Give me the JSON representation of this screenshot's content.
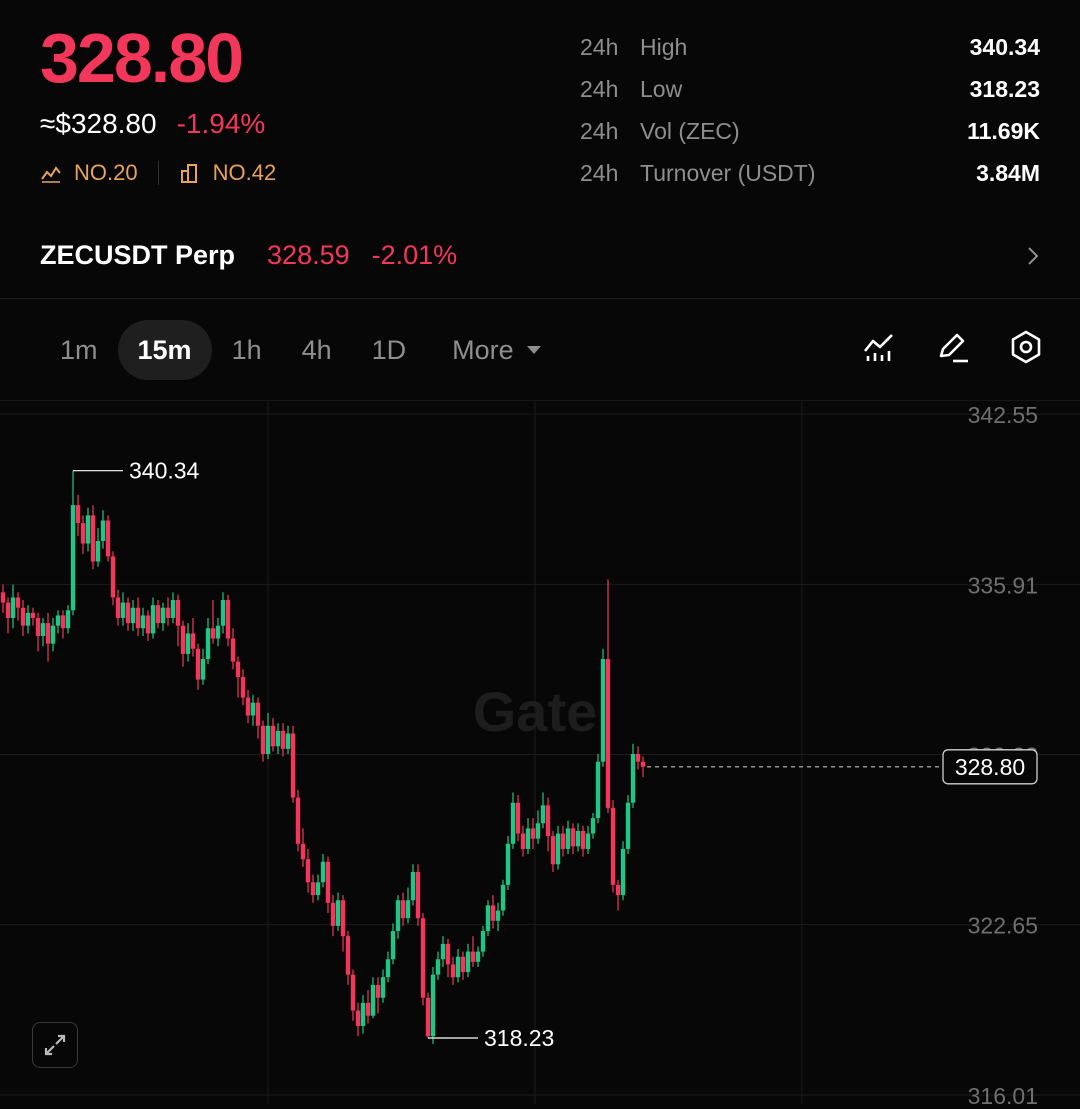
{
  "ticker": {
    "last_price": "328.80",
    "usd_price": "≈$328.80",
    "change_pct": "-1.94%",
    "rank_1": "NO.20",
    "rank_2": "NO.42"
  },
  "stats": [
    {
      "period": "24h",
      "name": "High",
      "value": "340.34"
    },
    {
      "period": "24h",
      "name": "Low",
      "value": "318.23"
    },
    {
      "period": "24h",
      "name": "Vol (ZEC)",
      "value": "11.69K"
    },
    {
      "period": "24h",
      "name": "Turnover (USDT)",
      "value": "3.84M"
    }
  ],
  "perp": {
    "symbol": "ZECUSDT Perp",
    "price": "328.59",
    "change": "-2.01%"
  },
  "timeframes": {
    "items": [
      "1m",
      "15m",
      "1h",
      "4h",
      "1D"
    ],
    "active": "15m",
    "more_label": "More"
  },
  "icons": {
    "indicator": "indicator-icon",
    "draw": "pencil-icon",
    "settings": "settings-hexagon-icon",
    "expand": "expand-icon"
  },
  "colors": {
    "up": "#1fc685",
    "down": "#f2375b",
    "rank": "#e8a25a",
    "background": "#070707"
  },
  "chart_data": {
    "type": "candlestick",
    "watermark": "Gate",
    "y_ticks": [
      "342.55",
      "335.91",
      "329.28",
      "322.65",
      "316.01"
    ],
    "ylim": [
      316.01,
      342.55
    ],
    "last_price_label": "328.80",
    "last_price": 328.8,
    "high_label": "340.34",
    "high": 340.34,
    "low_label": "318.23",
    "low": 318.23,
    "candles": [
      [
        335.6,
        335.2,
        335.9,
        334.8
      ],
      [
        335.2,
        334.6,
        335.4,
        334.0
      ],
      [
        334.6,
        335.4,
        335.9,
        334.2
      ],
      [
        335.4,
        335.0,
        335.6,
        334.5
      ],
      [
        335.0,
        334.3,
        335.3,
        333.9
      ],
      [
        334.3,
        334.8,
        335.1,
        334.0
      ],
      [
        334.8,
        334.6,
        335.0,
        334.3
      ],
      [
        334.6,
        333.9,
        334.8,
        333.3
      ],
      [
        333.9,
        334.4,
        334.6,
        333.5
      ],
      [
        334.4,
        333.6,
        334.8,
        332.9
      ],
      [
        333.6,
        334.3,
        334.6,
        333.3
      ],
      [
        334.3,
        334.7,
        334.9,
        334.0
      ],
      [
        334.7,
        334.2,
        334.9,
        333.8
      ],
      [
        334.2,
        334.9,
        335.1,
        334.0
      ],
      [
        334.9,
        339.0,
        340.34,
        334.7
      ],
      [
        339.0,
        338.3,
        339.4,
        337.8
      ],
      [
        338.3,
        337.5,
        338.6,
        337.1
      ],
      [
        337.5,
        338.6,
        338.9,
        337.2
      ],
      [
        338.6,
        336.8,
        339.0,
        336.5
      ],
      [
        336.8,
        337.6,
        338.1,
        336.6
      ],
      [
        337.6,
        338.4,
        338.8,
        337.3
      ],
      [
        338.4,
        337.0,
        338.6,
        336.8
      ],
      [
        337.0,
        335.4,
        337.2,
        335.1
      ],
      [
        335.4,
        334.6,
        335.7,
        334.3
      ],
      [
        334.6,
        335.2,
        335.6,
        334.3
      ],
      [
        335.2,
        334.4,
        335.4,
        334.1
      ],
      [
        334.4,
        335.0,
        335.3,
        334.1
      ],
      [
        335.0,
        334.2,
        335.4,
        333.9
      ],
      [
        334.2,
        334.7,
        335.0,
        333.9
      ],
      [
        334.7,
        334.0,
        334.9,
        333.7
      ],
      [
        334.0,
        335.1,
        335.4,
        333.8
      ],
      [
        335.1,
        334.4,
        335.3,
        334.2
      ],
      [
        334.4,
        335.0,
        335.2,
        334.1
      ],
      [
        335.0,
        334.6,
        335.4,
        334.3
      ],
      [
        334.6,
        335.3,
        335.6,
        334.4
      ],
      [
        335.3,
        334.3,
        335.5,
        333.5
      ],
      [
        334.3,
        333.2,
        334.5,
        332.7
      ],
      [
        333.2,
        334.0,
        334.4,
        332.9
      ],
      [
        334.0,
        333.4,
        334.6,
        333.1
      ],
      [
        333.4,
        332.2,
        333.6,
        331.8
      ],
      [
        332.2,
        333.0,
        333.4,
        332.0
      ],
      [
        333.0,
        334.2,
        334.6,
        332.8
      ],
      [
        334.2,
        333.8,
        335.3,
        333.6
      ],
      [
        333.8,
        334.3,
        334.6,
        333.5
      ],
      [
        334.3,
        335.3,
        335.6,
        334.0
      ],
      [
        335.3,
        333.8,
        335.5,
        333.5
      ],
      [
        333.8,
        332.9,
        334.2,
        332.6
      ],
      [
        332.9,
        332.3,
        333.1,
        331.5
      ],
      [
        332.3,
        331.5,
        332.6,
        331.2
      ],
      [
        331.5,
        330.8,
        331.8,
        330.5
      ],
      [
        330.8,
        331.3,
        331.6,
        330.4
      ],
      [
        331.3,
        330.4,
        331.5,
        329.9
      ],
      [
        330.4,
        329.3,
        330.6,
        329.0
      ],
      [
        329.3,
        330.4,
        330.9,
        329.1
      ],
      [
        330.4,
        329.6,
        330.7,
        329.4
      ],
      [
        329.6,
        330.2,
        330.5,
        329.3
      ],
      [
        330.2,
        329.5,
        330.5,
        329.2
      ],
      [
        329.5,
        330.1,
        330.4,
        329.3
      ],
      [
        330.1,
        327.6,
        330.4,
        327.4
      ],
      [
        327.6,
        325.8,
        327.9,
        325.5
      ],
      [
        325.8,
        325.2,
        326.4,
        324.9
      ],
      [
        325.2,
        324.3,
        325.6,
        323.9
      ],
      [
        324.3,
        323.8,
        324.6,
        323.5
      ],
      [
        323.8,
        324.3,
        324.6,
        323.6
      ],
      [
        324.3,
        325.1,
        325.4,
        324.1
      ],
      [
        325.1,
        323.5,
        325.3,
        323.1
      ],
      [
        323.5,
        322.6,
        323.8,
        322.2
      ],
      [
        322.6,
        323.6,
        323.9,
        322.4
      ],
      [
        323.6,
        322.2,
        323.8,
        321.6
      ],
      [
        322.2,
        320.7,
        322.4,
        320.3
      ],
      [
        320.7,
        319.3,
        320.9,
        318.9
      ],
      [
        319.3,
        318.7,
        319.6,
        318.3
      ],
      [
        318.7,
        319.6,
        319.9,
        318.4
      ],
      [
        319.6,
        319.1,
        320.1,
        318.8
      ],
      [
        319.1,
        320.3,
        320.6,
        319.0
      ],
      [
        320.3,
        319.8,
        320.6,
        319.2
      ],
      [
        319.8,
        320.6,
        320.9,
        319.6
      ],
      [
        320.6,
        321.3,
        321.6,
        320.4
      ],
      [
        321.3,
        322.4,
        322.7,
        321.1
      ],
      [
        322.4,
        323.6,
        323.8,
        322.1
      ],
      [
        323.6,
        322.9,
        323.9,
        322.6
      ],
      [
        322.9,
        323.6,
        324.1,
        322.7
      ],
      [
        323.6,
        324.7,
        325.0,
        323.4
      ],
      [
        324.7,
        322.9,
        325.0,
        322.6
      ],
      [
        322.9,
        319.8,
        323.1,
        319.5
      ],
      [
        319.8,
        318.3,
        320.0,
        318.23
      ],
      [
        318.3,
        320.7,
        321.0,
        318.0
      ],
      [
        320.7,
        321.3,
        321.6,
        320.5
      ],
      [
        321.3,
        321.9,
        322.2,
        321.0
      ],
      [
        321.9,
        321.1,
        322.1,
        320.6
      ],
      [
        321.1,
        320.6,
        321.4,
        320.3
      ],
      [
        320.6,
        321.4,
        321.7,
        320.4
      ],
      [
        321.4,
        320.8,
        321.6,
        320.5
      ],
      [
        320.8,
        321.6,
        321.9,
        320.6
      ],
      [
        321.6,
        321.2,
        322.2,
        321.0
      ],
      [
        321.2,
        321.6,
        321.8,
        321.0
      ],
      [
        321.6,
        322.4,
        322.6,
        321.4
      ],
      [
        322.4,
        323.4,
        323.6,
        322.2
      ],
      [
        323.4,
        322.8,
        323.8,
        322.5
      ],
      [
        322.8,
        323.2,
        323.5,
        322.4
      ],
      [
        323.2,
        324.2,
        324.4,
        323.0
      ],
      [
        324.2,
        325.8,
        326.1,
        324.0
      ],
      [
        325.8,
        327.4,
        327.8,
        325.6
      ],
      [
        327.4,
        326.2,
        327.7,
        325.9
      ],
      [
        326.2,
        325.6,
        326.5,
        325.3
      ],
      [
        325.6,
        326.4,
        326.8,
        325.4
      ],
      [
        326.4,
        326.0,
        326.8,
        325.6
      ],
      [
        326.0,
        326.6,
        327.1,
        325.8
      ],
      [
        326.6,
        327.3,
        327.8,
        326.4
      ],
      [
        327.3,
        326.1,
        327.6,
        325.5
      ],
      [
        326.1,
        325.0,
        326.3,
        324.7
      ],
      [
        325.0,
        326.2,
        326.5,
        324.8
      ],
      [
        326.2,
        325.6,
        326.5,
        325.3
      ],
      [
        325.6,
        326.4,
        326.7,
        325.4
      ],
      [
        326.4,
        325.7,
        326.6,
        325.4
      ],
      [
        325.7,
        326.3,
        326.6,
        325.5
      ],
      [
        326.3,
        325.6,
        326.5,
        325.3
      ],
      [
        325.6,
        326.2,
        326.5,
        325.4
      ],
      [
        326.2,
        326.8,
        327.0,
        326.0
      ],
      [
        326.8,
        329.0,
        329.3,
        326.6
      ],
      [
        329.0,
        333.0,
        333.4,
        328.8
      ],
      [
        333.0,
        327.2,
        336.1,
        327.0
      ],
      [
        327.2,
        324.2,
        327.5,
        323.9
      ],
      [
        324.2,
        323.8,
        324.4,
        323.2
      ],
      [
        323.8,
        325.6,
        325.9,
        323.6
      ],
      [
        325.6,
        327.4,
        327.7,
        325.4
      ],
      [
        327.4,
        329.3,
        329.7,
        327.2
      ],
      [
        329.3,
        329.0,
        329.6,
        328.7
      ],
      [
        329.0,
        328.8,
        329.2,
        328.4
      ]
    ]
  }
}
